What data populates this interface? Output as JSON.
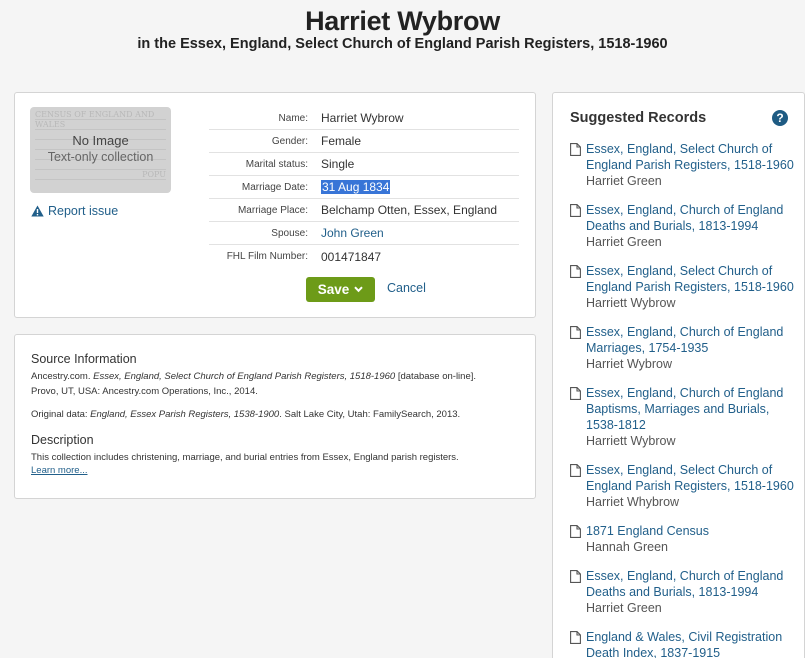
{
  "header": {
    "title": "Harriet Wybrow",
    "subtitle": "in the Essex, England, Select Church of England Parish Registers, 1518-1960"
  },
  "record": {
    "thumbnail": {
      "no_image": "No Image",
      "text_only": "Text-only collection",
      "bg_lines": [
        "CENSUS OF ENGLAND AND WALES",
        "",
        "",
        "",
        "",
        "",
        "POPU"
      ]
    },
    "report_issue": "Report issue",
    "fields": [
      {
        "label": "Name:",
        "value": "Harriet Wybrow"
      },
      {
        "label": "Gender:",
        "value": "Female"
      },
      {
        "label": "Marital status:",
        "value": "Single"
      },
      {
        "label": "Marriage Date:",
        "value": "31 Aug 1834"
      },
      {
        "label": "Marriage Place:",
        "value": "Belchamp Otten, Essex, England"
      },
      {
        "label": "Spouse:",
        "value": "John Green"
      },
      {
        "label": "FHL Film Number:",
        "value": "001471847"
      }
    ],
    "save_label": "Save",
    "cancel_label": "Cancel"
  },
  "source": {
    "heading": "Source Information",
    "line1_pre": "Ancestry.com. ",
    "line1_italic": "Essex, England, Select Church of England Parish Registers, 1518-1960",
    "line1_post": " [database on-line].",
    "line2": "Provo, UT, USA: Ancestry.com Operations, Inc., 2014.",
    "orig_pre": "Original data: ",
    "orig_italic": "England, Essex Parish Registers, 1538-1900",
    "orig_post": ". Salt Lake City, Utah: FamilySearch, 2013.",
    "desc_heading": "Description",
    "desc_text": "This collection includes christening, marriage, and burial entries from Essex, England parish registers.",
    "learn_more": "Learn more..."
  },
  "suggested": {
    "title": "Suggested Records",
    "help": "?",
    "items": [
      {
        "link": "Essex, England, Select Church of England Parish Registers, 1518-1960",
        "name": "Harriet Green"
      },
      {
        "link": "Essex, England, Church of England Deaths and Burials, 1813-1994",
        "name": "Harriet Green"
      },
      {
        "link": "Essex, England, Select Church of England Parish Registers, 1518-1960",
        "name": "Harriett Wybrow"
      },
      {
        "link": "Essex, England, Church of England Marriages, 1754-1935",
        "name": "Harriet Wybrow"
      },
      {
        "link": "Essex, England, Church of England Baptisms, Marriages and Burials, 1538-1812",
        "name": "Harriett Wybrow"
      },
      {
        "link": "Essex, England, Select Church of England Parish Registers, 1518-1960",
        "name": "Harriet Whybrow"
      },
      {
        "link": "1871 England Census",
        "name": "Hannah Green"
      },
      {
        "link": "Essex, England, Church of England Deaths and Burials, 1813-1994",
        "name": "Harriet Green"
      },
      {
        "link": "England & Wales, Civil Registration Death Index, 1837-1915",
        "name": ""
      }
    ]
  },
  "colors": {
    "accent_link": "#215f8a",
    "save_green": "#6d9b18",
    "selection": "#3875d7"
  },
  "icons": {
    "report": "warning-icon",
    "doc": "document-icon",
    "help": "help-icon",
    "save_chevron": "chevron-down-icon"
  }
}
